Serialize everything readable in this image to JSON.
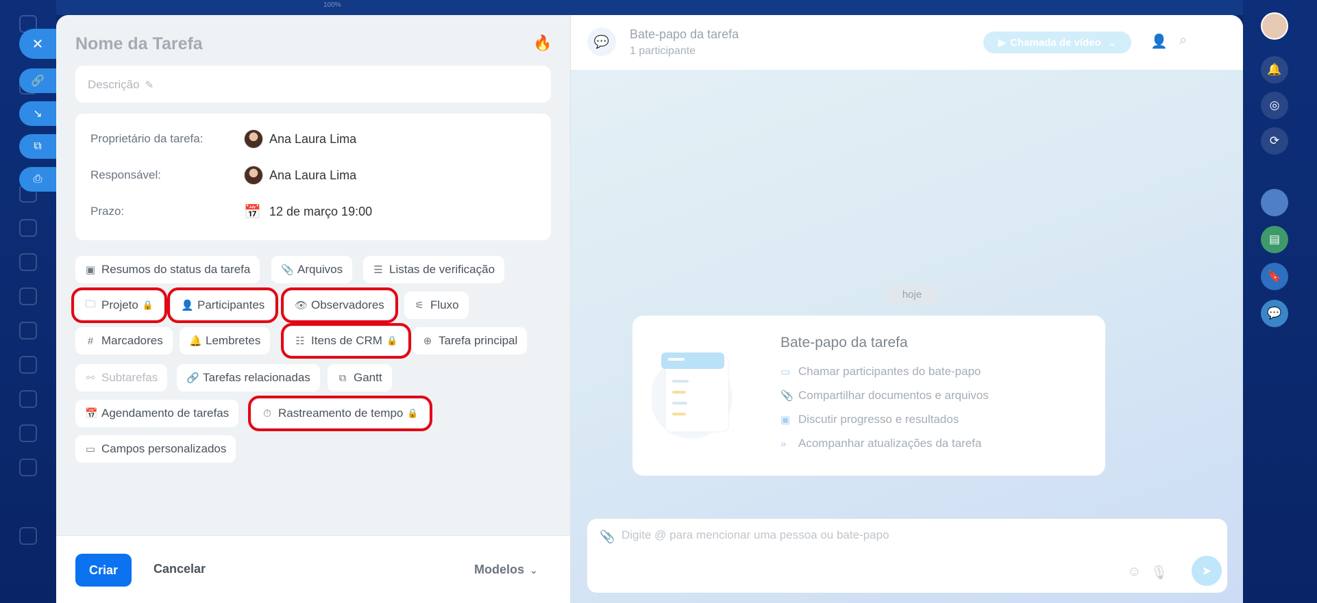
{
  "topbar": {
    "zoom": "100%"
  },
  "task": {
    "title_placeholder": "Nome da Tarefa",
    "description_placeholder": "Descrição"
  },
  "info": {
    "owner_label": "Proprietário da tarefa:",
    "owner_name": "Ana Laura Lima",
    "assignee_label": "Responsável:",
    "assignee_name": "Ana Laura Lima",
    "deadline_label": "Prazo:",
    "deadline_value": "12 de março 19:00"
  },
  "chips": {
    "status_summaries": "Resumos do status da tarefa",
    "files": "Arquivos",
    "checklists": "Listas de verificação",
    "project": "Projeto",
    "participants": "Participantes",
    "observers": "Observadores",
    "flow": "Fluxo",
    "tags": "Marcadores",
    "reminders": "Lembretes",
    "crm_items": "Itens de CRM",
    "parent_task": "Tarefa principal",
    "subtasks": "Subtarefas",
    "related_tasks": "Tarefas relacionadas",
    "gantt": "Gantt",
    "scheduling": "Agendamento de tarefas",
    "time_tracking": "Rastreamento de tempo",
    "custom_fields": "Campos personalizados"
  },
  "footer": {
    "create": "Criar",
    "cancel": "Cancelar",
    "templates": "Modelos"
  },
  "chat": {
    "title": "Bate-papo da tarefa",
    "participants": "1 participante",
    "video_call": "Chamada de vídeo",
    "today": "hoje",
    "welcome_title": "Bate-papo da tarefa",
    "features": [
      "Chamar participantes do bate-papo",
      "Compartilhar documentos e arquivos",
      "Discutir progresso e resultados",
      "Acompanhar atualizações da tarefa"
    ],
    "composer_placeholder": "Digite @ para mencionar uma pessoa ou bate-papo"
  },
  "colors": {
    "accent": "#0b72f0",
    "highlight": "#e30613",
    "lock": "#2f8be6"
  }
}
